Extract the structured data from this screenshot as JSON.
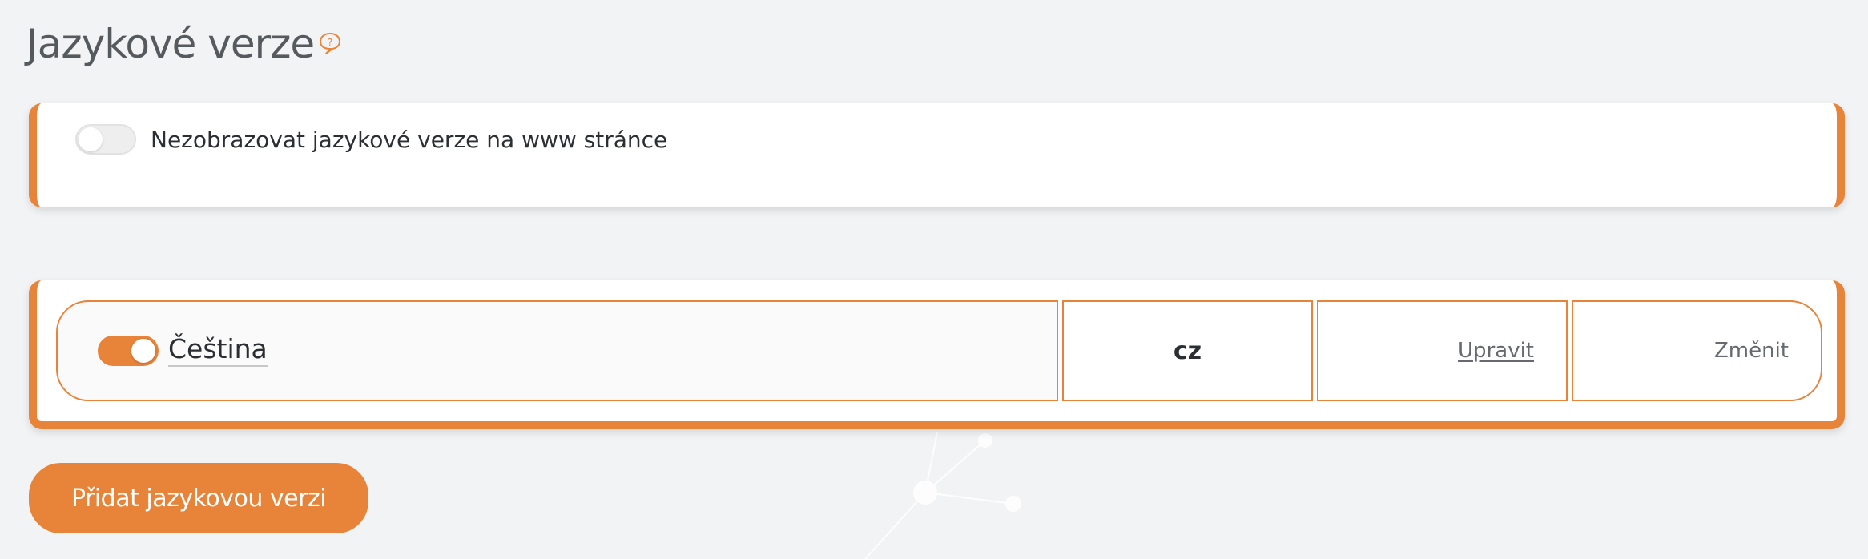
{
  "header": {
    "title": "Jazykové verze",
    "help_icon": "question-speech-bubble-icon"
  },
  "display_setting": {
    "toggle_on": false,
    "label": "Nezobrazovat jazykové verze na www stránce"
  },
  "languages": [
    {
      "enabled": true,
      "name": "Čeština",
      "code": "cz",
      "edit_label": "Upravit",
      "change_label": "Změnit"
    }
  ],
  "actions": {
    "add_label": "Přidat jazykovou verzi"
  },
  "colors": {
    "accent": "#e8833a",
    "background": "#f2f3f5",
    "text": "#2b2f33",
    "muted": "#666a6e"
  }
}
